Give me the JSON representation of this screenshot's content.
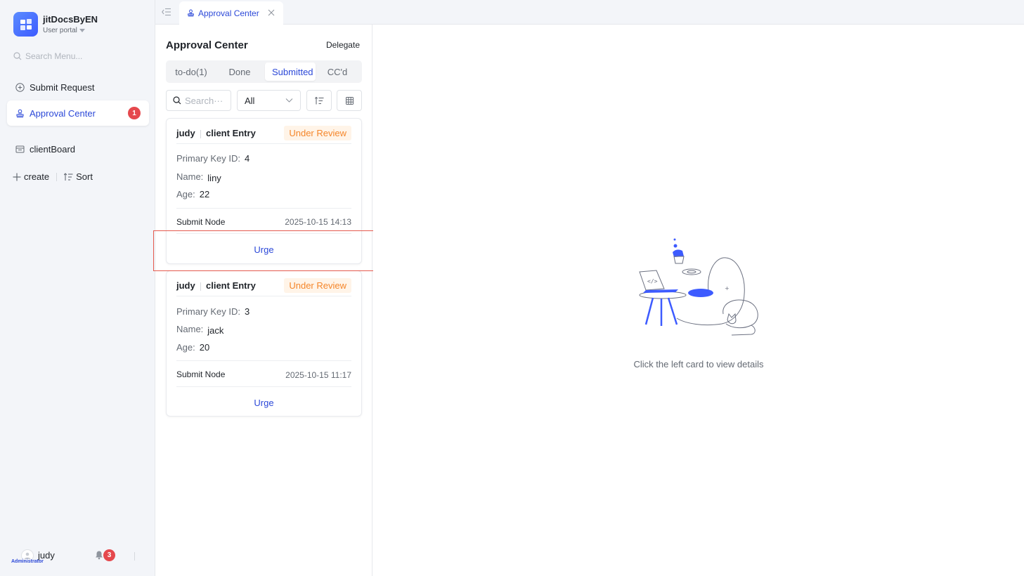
{
  "app": {
    "name": "jitDocsByEN",
    "portal": "User portal"
  },
  "sidebar": {
    "search_placeholder": "Search Menu...",
    "items": [
      {
        "label": "Submit Request"
      },
      {
        "label": "Approval Center",
        "badge": "1"
      },
      {
        "label": "clientBoard"
      }
    ],
    "create_label": "create",
    "sort_label": "Sort"
  },
  "user": {
    "name": "judy",
    "role": "Administrator",
    "notifications": "3"
  },
  "tabs": [
    {
      "label": "Approval Center"
    }
  ],
  "list_panel": {
    "title": "Approval Center",
    "delegate_label": "Delegate",
    "segments": [
      "to-do(1)",
      "Done",
      "Submitted",
      "CC'd"
    ],
    "search_placeholder": "Search···",
    "filter_value": "All",
    "cards": [
      {
        "submitter": "judy",
        "form": "client Entry",
        "status": "Under Review",
        "fields": [
          {
            "label": "Primary Key ID:",
            "value": "4"
          },
          {
            "label": "Name:",
            "value": "liny"
          },
          {
            "label": "Age:",
            "value": "22"
          }
        ],
        "node": "Submit Node",
        "time": "2025-10-15 14:13",
        "action": "Urge"
      },
      {
        "submitter": "judy",
        "form": "client Entry",
        "status": "Under Review",
        "fields": [
          {
            "label": "Primary Key ID:",
            "value": "3"
          },
          {
            "label": "Name:",
            "value": "jack"
          },
          {
            "label": "Age:",
            "value": "20"
          }
        ],
        "node": "Submit Node",
        "time": "2025-10-15 11:17",
        "action": "Urge"
      }
    ]
  },
  "detail": {
    "empty_text": "Click the left card to view details"
  },
  "colors": {
    "accent": "#2b48d8",
    "badge": "#e5484d",
    "status": "#f5862a",
    "highlight": "#e55a4e"
  }
}
